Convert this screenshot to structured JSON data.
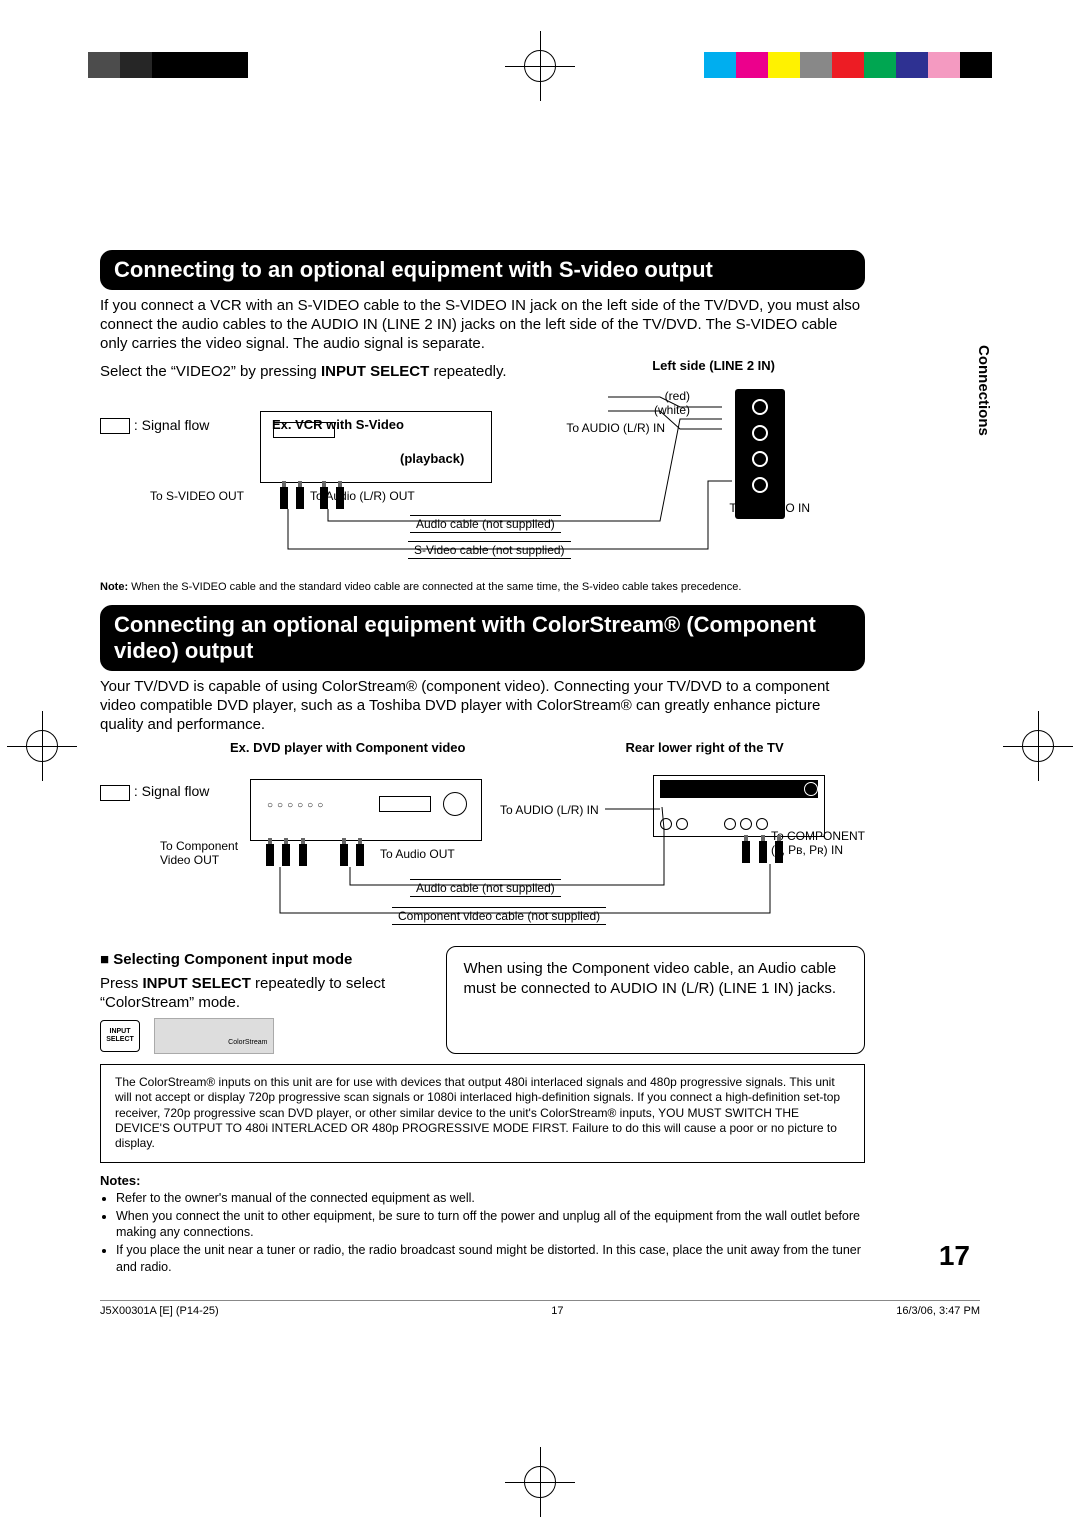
{
  "printerColors": [
    "#00AEEF",
    "#EC008C",
    "#FFF200",
    "#888888",
    "#ED1C24",
    "#00A651",
    "#2E3192",
    "#F49AC1",
    "#000000"
  ],
  "sideTab": "Connections",
  "section1": {
    "title": "Connecting to an optional equipment with S-video output",
    "intro": "If you connect a VCR with an S-VIDEO cable to the S-VIDEO IN jack on the left side of the TV/DVD, you must also connect the audio cables to the AUDIO IN (LINE 2 IN) jacks on the left side of the TV/DVD. The S-VIDEO cable only carries the video signal. The audio signal is separate.",
    "select": "Select the “VIDEO2” by pressing INPUT SELECT repeatedly.",
    "leftSideLabel": "Left side (LINE 2 IN)",
    "signalFlow": ": Signal flow",
    "vcrLabel": "Ex.  VCR with S-Video",
    "playback": "(playback)",
    "red": "(red)",
    "white": "(white)",
    "toAudioLRIn": "To AUDIO (L/R) IN",
    "toSVideoOut": "To S-VIDEO OUT",
    "toAudioLROut": "To Audio (L/R) OUT",
    "toSVideoIn": "To S-VIDEO IN",
    "audioCable": "Audio cable (not supplied)",
    "sVideoCable": "S-Video cable (not supplied)",
    "note": "Note: When the S-VIDEO cable and the standard video cable are connected at the same time, the S-video cable takes precedence."
  },
  "section2": {
    "title": "Connecting an optional equipment with ColorStream® (Component video) output",
    "intro": "Your TV/DVD is capable of using ColorStream® (component video). Connecting your TV/DVD to a component video compatible DVD player, such as a Toshiba DVD player with ColorStream® can greatly enhance picture quality and performance.",
    "dvdLabel": "Ex. DVD player with Component video",
    "rearLabel": "Rear lower right of the TV",
    "signalFlow": ": Signal flow",
    "toComponentOut": "To Component\nVideo OUT",
    "toAudioOut": "To Audio OUT",
    "toAudioLRIn": "To AUDIO (L/R) IN",
    "toComponentIn": "To COMPONENT\n(Y, Pʙ, Pʀ) IN",
    "audioCable": "Audio cable (not supplied)",
    "componentCable": "Component video cable (not supplied)",
    "selectingHeader": "■ Selecting Component input mode",
    "selectingBody": "Press INPUT SELECT repeatedly to select “ColorStream” mode.",
    "btnTop": "INPUT",
    "btnBottom": "SELECT",
    "screenText": "ColorStream",
    "calloutBox": "When using the Component video cable, an Audio cable must be connected to AUDIO IN (L/R) (LINE 1 IN) jacks.",
    "bigNote": "The ColorStream® inputs on this unit are for use with devices that output 480i interlaced signals and 480p progressive signals. This unit will not accept or display 720p progressive scan signals or 1080i interlaced high-definition signals. If you connect a high-definition set-top receiver, 720p progressive scan DVD player, or other similar device to the unit's ColorStream® inputs, YOU MUST SWITCH THE DEVICE'S OUTPUT TO 480i INTERLACED OR 480p PROGRESSIVE MODE FIRST. Failure to do this will cause a poor or no picture to display."
  },
  "notes": {
    "header": "Notes:",
    "items": [
      "Refer to the owner's manual of the connected equipment as well.",
      "When you connect the unit to other equipment, be sure to turn off the power and unplug all of the equipment from the wall outlet before making any connections.",
      "If you place the unit near a tuner or radio, the radio broadcast sound might be distorted. In this case, place the unit away from the tuner and radio."
    ]
  },
  "pageNumber": "17",
  "footer": {
    "left": "J5X00301A [E] (P14-25)",
    "center": "17",
    "right": "16/3/06, 3:47 PM"
  }
}
